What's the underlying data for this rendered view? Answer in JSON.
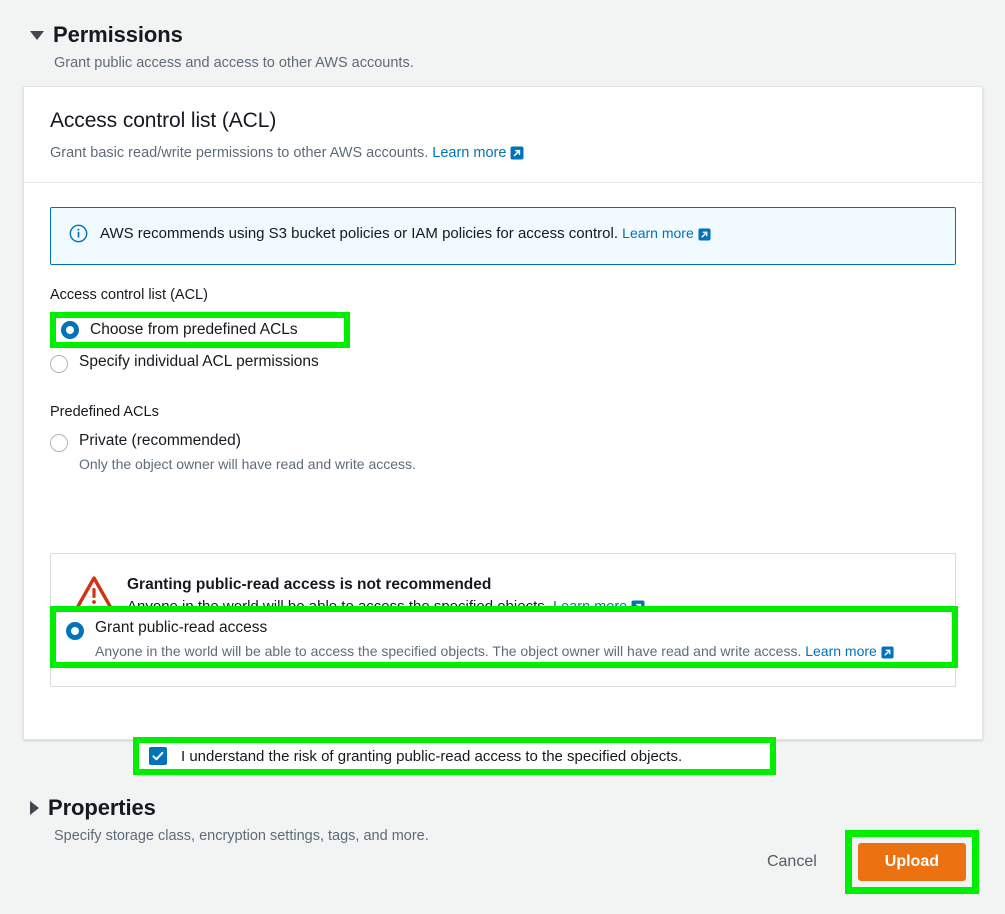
{
  "colors": {
    "highlight_green": "#00ef00",
    "link_blue": "#0073bb",
    "upload_orange": "#ec7211",
    "warning_red": "#d13212",
    "page_bg": "#f2f3f3"
  },
  "permissions_section": {
    "title": "Permissions",
    "description": "Grant public access and access to other AWS accounts.",
    "expanded": true,
    "toggle_icon": "caret-down-icon"
  },
  "acl_card": {
    "title": "Access control list (ACL)",
    "description": "Grant basic read/write permissions to other AWS accounts.",
    "learn_more": "Learn more",
    "external_link_icon": "external-link-icon"
  },
  "info_alert": {
    "icon": "info-circle-icon",
    "text": "AWS recommends using S3 bucket policies or IAM policies for access control.",
    "learn_more": "Learn more"
  },
  "acl_choice": {
    "label": "Access control list (ACL)",
    "options": [
      {
        "label": "Choose from predefined ACLs",
        "selected": true,
        "highlighted": true
      },
      {
        "label": "Specify individual ACL permissions",
        "selected": false,
        "highlighted": false
      }
    ]
  },
  "predefined_acls": {
    "label": "Predefined ACLs",
    "options": [
      {
        "label": "Private (recommended)",
        "description": "Only the object owner will have read and write access.",
        "selected": false,
        "highlighted": false,
        "learn_more": ""
      },
      {
        "label": "Grant public-read access",
        "description": "Anyone in the world will be able to access the specified objects. The object owner will have read and write access.",
        "selected": true,
        "highlighted": true,
        "learn_more": "Learn more"
      }
    ]
  },
  "warning": {
    "icon": "warning-triangle-icon",
    "title": "Granting public-read access is not recommended",
    "text": "Anyone in the world will be able to access the specified objects.",
    "learn_more": "Learn more",
    "acknowledgement": {
      "label": "I understand the risk of granting public-read access to the specified objects.",
      "checked": true,
      "highlighted": true
    }
  },
  "properties_section": {
    "title": "Properties",
    "description": "Specify storage class, encryption settings, tags, and more.",
    "expanded": false,
    "toggle_icon": "caret-right-icon"
  },
  "footer": {
    "cancel_label": "Cancel",
    "upload_label": "Upload",
    "upload_highlighted": true
  }
}
